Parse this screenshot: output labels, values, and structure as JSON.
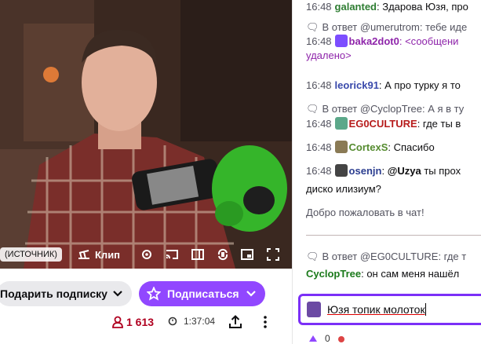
{
  "video": {
    "source_label": "(ИСТОЧНИК)",
    "clip_label": "Клип"
  },
  "actions": {
    "gift_label": "Подарить подписку",
    "subscribe_label": "Подписаться",
    "viewers": "1 613",
    "uptime": "1:37:04"
  },
  "chat": {
    "messages": [
      {
        "time": "16:48",
        "user": "galanted",
        "text": ": Здарова Юзя, про"
      },
      {
        "reply": "В ответ @umerutrom: тебе иде"
      },
      {
        "time": "16:48",
        "user": "baka2dot0",
        "text": ": <сообщени"
      },
      {
        "text": "удалено>"
      },
      {
        "time": "16:48",
        "user": "leorick91",
        "text": ": А про турку я то"
      },
      {
        "reply": "В ответ @CyclopTree: А я в ту"
      },
      {
        "time": "16:48",
        "user": "EG0CULTURE",
        "text": ": где ты в"
      },
      {
        "time": "16:48",
        "user": "CortexS",
        "text": ": Спасибо"
      },
      {
        "time": "16:48",
        "user": "osenjn",
        "text": ": ",
        "mention": "@Uzya",
        "text2": " ты прох"
      },
      {
        "text": "диско илизиум?"
      },
      {
        "text": "Добро пожаловать в чат!"
      },
      {
        "reply": "В ответ @EG0CULTURE: где т"
      },
      {
        "user": "CyclopTree",
        "text": ": он сам меня нашёл"
      }
    ],
    "input_value": "Юзя топик молоток",
    "bottom_count": "0"
  },
  "colors": {
    "accent": "#9147ff",
    "input_border": "#7b2ff7",
    "galanted": "#2e7d32",
    "baka2dot0": "#8e24aa",
    "leorick91": "#3949ab",
    "EG0CULTURE": "#b71c1c",
    "CortexS": "#558b2f",
    "osenjn": "#2c3e90",
    "CyclopTree": "#1b7a1b",
    "viewers": "#b00020"
  }
}
